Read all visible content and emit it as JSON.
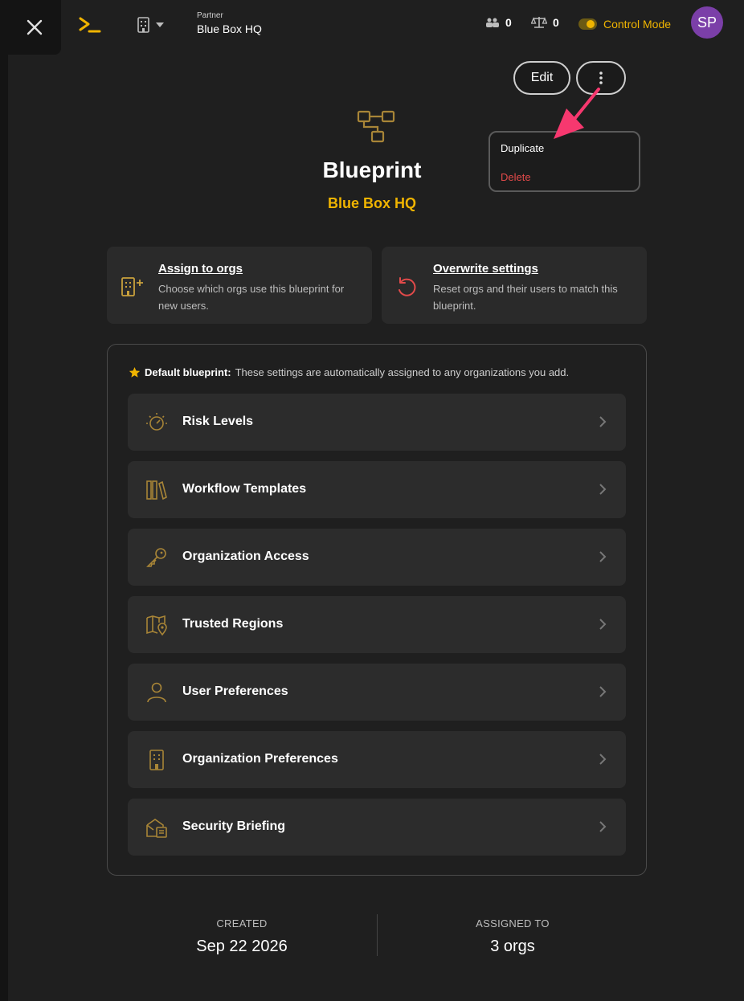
{
  "topbar": {
    "partner_label": "Partner",
    "partner_name": "Blue Box HQ",
    "stat_users": "0",
    "stat_policies": "0",
    "control_mode_label": "Control Mode",
    "avatar_initials": "SP"
  },
  "header": {
    "edit_label": "Edit",
    "title": "Blueprint",
    "subtitle": "Blue Box HQ"
  },
  "menu": {
    "duplicate": "Duplicate",
    "delete": "Delete"
  },
  "actions": [
    {
      "title": "Assign to orgs",
      "description": "Choose which orgs use this blueprint for new users."
    },
    {
      "title": "Overwrite settings",
      "description": "Reset orgs and their users to match this blueprint."
    }
  ],
  "settings": {
    "default_label": "Default blueprint:",
    "default_note": "These settings are automatically assigned to any organizations you add.",
    "rows": [
      {
        "label": "Risk Levels",
        "icon": "gauge-icon"
      },
      {
        "label": "Workflow Templates",
        "icon": "books-icon"
      },
      {
        "label": "Organization Access",
        "icon": "key-icon"
      },
      {
        "label": "Trusted Regions",
        "icon": "map-pin-icon"
      },
      {
        "label": "User Preferences",
        "icon": "user-icon"
      },
      {
        "label": "Organization Preferences",
        "icon": "building-icon"
      },
      {
        "label": "Security Briefing",
        "icon": "envelope-icon"
      }
    ]
  },
  "footer": {
    "created_label": "CREATED",
    "created_value": "Sep 22 2026",
    "assigned_label": "ASSIGNED TO",
    "assigned_value": "3 orgs"
  },
  "colors": {
    "accent": "#f0b400",
    "danger": "#e24a4a",
    "background": "#1f1f1f",
    "card": "#2c2c2c",
    "avatar": "#7b3fa8",
    "annotation_arrow": "#f7386f"
  }
}
